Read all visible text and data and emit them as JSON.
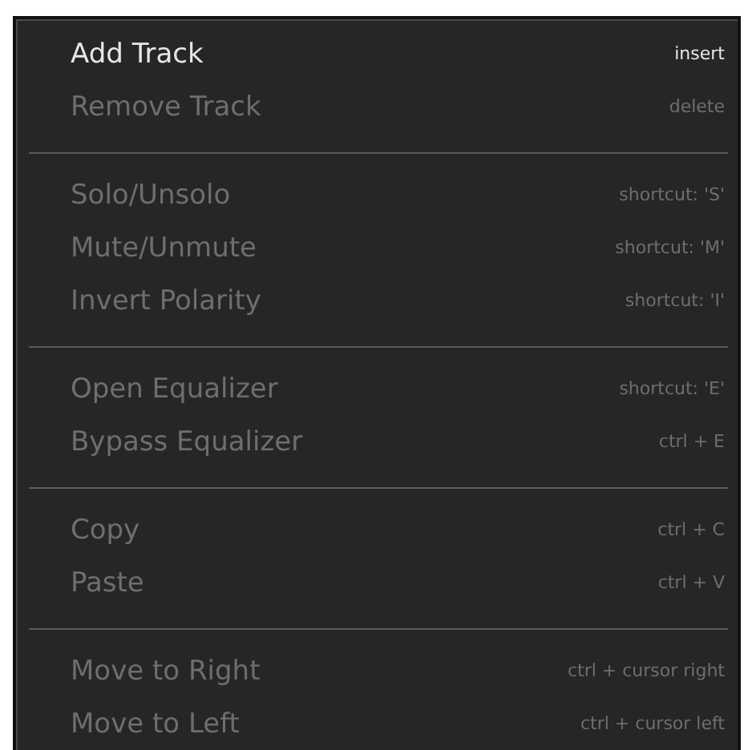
{
  "menu": {
    "groups": [
      {
        "items": [
          {
            "label": "Add Track",
            "shortcut": "insert",
            "disabled": false
          },
          {
            "label": "Remove Track",
            "shortcut": "delete",
            "disabled": true
          }
        ]
      },
      {
        "items": [
          {
            "label": "Solo/Unsolo",
            "shortcut": "shortcut: 'S'",
            "disabled": true
          },
          {
            "label": "Mute/Unmute",
            "shortcut": "shortcut: 'M'",
            "disabled": true
          },
          {
            "label": "Invert Polarity",
            "shortcut": "shortcut: 'I'",
            "disabled": true
          }
        ]
      },
      {
        "items": [
          {
            "label": "Open Equalizer",
            "shortcut": "shortcut: 'E'",
            "disabled": true
          },
          {
            "label": "Bypass Equalizer",
            "shortcut": "ctrl + E",
            "disabled": true
          }
        ]
      },
      {
        "items": [
          {
            "label": "Copy",
            "shortcut": "ctrl + C",
            "disabled": true
          },
          {
            "label": "Paste",
            "shortcut": "ctrl + V",
            "disabled": true
          }
        ]
      },
      {
        "items": [
          {
            "label": "Move to Right",
            "shortcut": "ctrl + cursor right",
            "disabled": true
          },
          {
            "label": "Move to Left",
            "shortcut": "ctrl + cursor left",
            "disabled": true
          }
        ]
      }
    ]
  }
}
